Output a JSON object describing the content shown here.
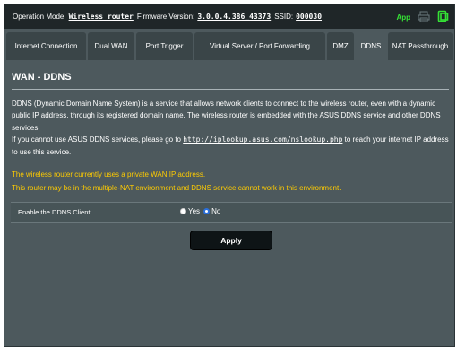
{
  "status": {
    "operation_mode_label": "Operation Mode:",
    "operation_mode_value": "Wireless router",
    "firmware_label": "Firmware Version:",
    "firmware_value": "3.0.0.4.386_43373",
    "ssid_label": "SSID:",
    "ssid_value": "000030",
    "app_label": "App",
    "icons": [
      "printer-icon",
      "usb-icon"
    ],
    "accent_color": "#35e335"
  },
  "tabs": [
    {
      "label": "Internet Connection",
      "active": false
    },
    {
      "label": "Dual WAN",
      "active": false
    },
    {
      "label": "Port Trigger",
      "active": false
    },
    {
      "label": "Virtual Server / Port Forwarding",
      "active": false
    },
    {
      "label": "DMZ",
      "active": false
    },
    {
      "label": "DDNS",
      "active": true
    },
    {
      "label": "NAT Passthrough",
      "active": false
    }
  ],
  "page": {
    "title": "WAN - DDNS",
    "description_1": "DDNS (Dynamic Domain Name System) is a service that allows network clients to connect to the wireless router, even with a dynamic public IP address, through its registered domain name. The wireless router is embedded with the ASUS DDNS service and other DDNS services.",
    "description_2_before": "If you cannot use ASUS DDNS services, please go to ",
    "description_2_link": "http://iplookup.asus.com/nslookup.php",
    "description_2_after": " to reach your internet IP address to use this service.",
    "warning_1": "The wireless router currently uses a private WAN IP address.",
    "warning_2": "This router may be in the multiple-NAT environment and DDNS service cannot work in this environment.",
    "warning_color": "#ffcc00"
  },
  "form": {
    "enable_label": "Enable the DDNS Client",
    "yes_label": "Yes",
    "no_label": "No",
    "selected": "No"
  },
  "apply_label": "Apply"
}
